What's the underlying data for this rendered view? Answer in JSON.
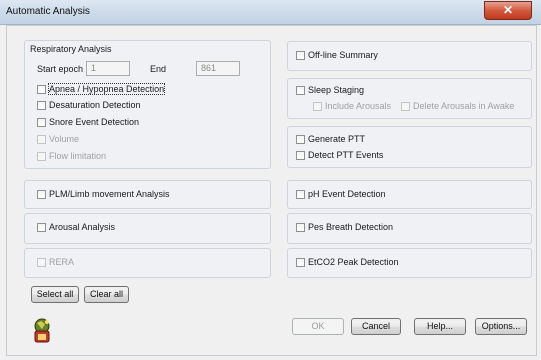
{
  "window": {
    "title": "Automatic Analysis",
    "close_glyph": "✕"
  },
  "respiratory": {
    "title": "Respiratory Analysis",
    "start_label": "Start epoch",
    "start_value": "1",
    "end_label": "End",
    "end_value": "861",
    "apnea": "Apnea / Hypopnea Detection",
    "desaturation": "Desaturation Detection",
    "snore": "Snore Event Detection",
    "volume": "Volume",
    "flow": "Flow limitation"
  },
  "plm": "PLM/Limb movement Analysis",
  "arousal": "Arousal Analysis",
  "rera": "RERA",
  "offline": "Off-line Summary",
  "sleep": {
    "staging": "Sleep Staging",
    "include_arousals": "Include Arousals",
    "delete_arousals": "Delete Arousals in Awake"
  },
  "ptt": {
    "generate": "Generate PTT",
    "detect": "Detect PTT Events"
  },
  "ph": "pH Event Detection",
  "pes": "Pes Breath Detection",
  "etco2": "EtCO2 Peak Detection",
  "buttons": {
    "select_all": "Select all",
    "clear_all": "Clear all",
    "ok": "OK",
    "cancel": "Cancel",
    "help": "Help...",
    "options": "Options..."
  },
  "icons": {
    "app": "analysis-wizard-icon"
  }
}
